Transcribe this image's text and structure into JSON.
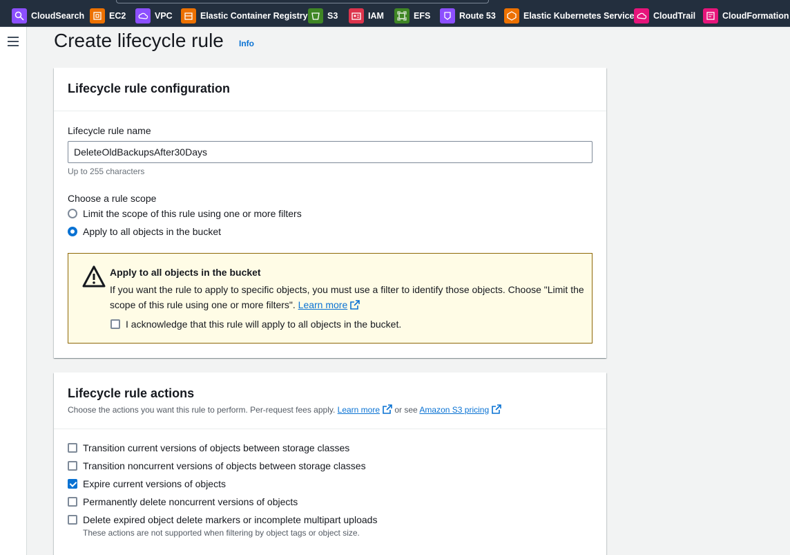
{
  "topbar": {
    "services": [
      {
        "label": "CloudSearch",
        "icon": "cloudsearch-icon",
        "color": "#8c4fff"
      },
      {
        "label": "EC2",
        "icon": "ec2-icon",
        "color": "#ed7100"
      },
      {
        "label": "VPC",
        "icon": "vpc-icon",
        "color": "#8c4fff"
      },
      {
        "label": "Elastic Container Registry",
        "icon": "ecr-icon",
        "color": "#ed7100"
      },
      {
        "label": "S3",
        "icon": "s3-icon",
        "color": "#3f8624"
      },
      {
        "label": "IAM",
        "icon": "iam-icon",
        "color": "#dd344c"
      },
      {
        "label": "EFS",
        "icon": "efs-icon",
        "color": "#3f8624"
      },
      {
        "label": "Route 53",
        "icon": "route53-icon",
        "color": "#8c4fff"
      },
      {
        "label": "Elastic Kubernetes Service",
        "icon": "eks-icon",
        "color": "#ed7100"
      },
      {
        "label": "CloudTrail",
        "icon": "cloudtrail-icon",
        "color": "#e7157b"
      },
      {
        "label": "CloudFormation",
        "icon": "cloudformation-icon",
        "color": "#e7157b"
      }
    ]
  },
  "page": {
    "title": "Create lifecycle rule",
    "info": "Info"
  },
  "config": {
    "title": "Lifecycle rule configuration",
    "name_label": "Lifecycle rule name",
    "name_value": "DeleteOldBackupsAfter30Days",
    "name_hint": "Up to 255 characters",
    "scope_label": "Choose a rule scope",
    "scope_options": [
      {
        "label": "Limit the scope of this rule using one or more filters",
        "selected": false
      },
      {
        "label": "Apply to all objects in the bucket",
        "selected": true
      }
    ],
    "alert": {
      "title": "Apply to all objects in the bucket",
      "body": "If you want the rule to apply to specific objects, you must use a filter to identify those objects. Choose \"Limit the scope of this rule using one or more filters\".",
      "learn_more": "Learn more",
      "acknowledge": "I acknowledge that this rule will apply to all objects in the bucket.",
      "acknowledged": false
    }
  },
  "actions": {
    "title": "Lifecycle rule actions",
    "desc_prefix": "Choose the actions you want this rule to perform. Per-request fees apply.",
    "learn_more": "Learn more",
    "or_see": "or see",
    "pricing": "Amazon S3 pricing",
    "items": [
      {
        "label": "Transition current versions of objects between storage classes",
        "checked": false
      },
      {
        "label": "Transition noncurrent versions of objects between storage classes",
        "checked": false
      },
      {
        "label": "Expire current versions of objects",
        "checked": true
      },
      {
        "label": "Permanently delete noncurrent versions of objects",
        "checked": false
      },
      {
        "label": "Delete expired object delete markers or incomplete multipart uploads",
        "checked": false
      }
    ],
    "note": "These actions are not supported when filtering by object tags or object size."
  }
}
